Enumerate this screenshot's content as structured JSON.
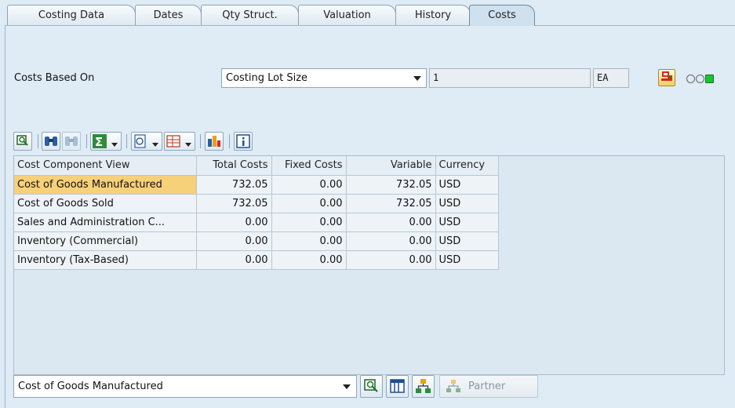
{
  "tabs": [
    "Costing Data",
    "Dates",
    "Qty Struct.",
    "Valuation",
    "History",
    "Costs"
  ],
  "active_tab": "Costs",
  "costs_based_on": {
    "label": "Costs Based On",
    "value": "Costing Lot Size",
    "quantity": "1",
    "unit": "EA"
  },
  "grid": {
    "columns": [
      "Cost Component View",
      "Total Costs",
      "Fixed Costs",
      "Variable",
      "Currency"
    ],
    "rows": [
      {
        "view": "Cost of Goods Manufactured",
        "total": "732.05",
        "fixed": "0.00",
        "variable": "732.05",
        "currency": "USD"
      },
      {
        "view": "Cost of Goods Sold",
        "total": "732.05",
        "fixed": "0.00",
        "variable": "732.05",
        "currency": "USD"
      },
      {
        "view": "Sales and Administration C...",
        "total": "0.00",
        "fixed": "0.00",
        "variable": "0.00",
        "currency": "USD"
      },
      {
        "view": "Inventory (Commercial)",
        "total": "0.00",
        "fixed": "0.00",
        "variable": "0.00",
        "currency": "USD"
      },
      {
        "view": "Inventory (Tax-Based)",
        "total": "0.00",
        "fixed": "0.00",
        "variable": "0.00",
        "currency": "USD"
      }
    ]
  },
  "bottom": {
    "view_value": "Cost of Goods Manufactured",
    "partner_label": "Partner"
  },
  "colors": {
    "selected_row": "#f7d07a",
    "background": "#dfebf5",
    "status_green": "#17c52f"
  }
}
